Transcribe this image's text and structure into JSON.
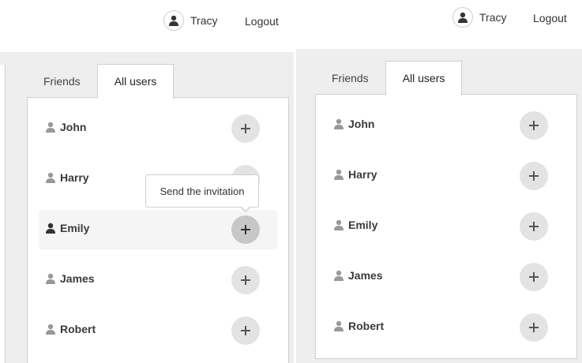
{
  "left_panel": {
    "user": {
      "name": "Tracy",
      "avatar_icon": "user-icon"
    },
    "logout_label": "Logout",
    "tabs": [
      {
        "label": "Friends",
        "active": false
      },
      {
        "label": "All users",
        "active": true
      }
    ],
    "users": [
      {
        "name": "John",
        "icon": "person-icon",
        "action_icon": "plus-icon"
      },
      {
        "name": "Harry",
        "icon": "person-icon",
        "action_icon": "plus-icon"
      },
      {
        "name": "Emily",
        "icon": "person-icon",
        "action_icon": "plus-icon",
        "hovered": true
      },
      {
        "name": "James",
        "icon": "person-icon",
        "action_icon": "plus-icon"
      },
      {
        "name": "Robert",
        "icon": "person-icon",
        "action_icon": "plus-icon"
      }
    ],
    "tooltip": "Send the invitation"
  },
  "right_panel": {
    "user": {
      "name": "Tracy",
      "avatar_icon": "user-icon"
    },
    "logout_label": "Logout",
    "tabs": [
      {
        "label": "Friends",
        "active": false
      },
      {
        "label": "All users",
        "active": true
      }
    ],
    "users": [
      {
        "name": "John",
        "icon": "person-icon",
        "action_icon": "plus-icon"
      },
      {
        "name": "Harry",
        "icon": "person-icon",
        "action_icon": "plus-icon"
      },
      {
        "name": "Emily",
        "icon": "person-icon",
        "action_icon": "plus-icon"
      },
      {
        "name": "James",
        "icon": "person-icon",
        "action_icon": "plus-icon"
      },
      {
        "name": "Robert",
        "icon": "person-icon",
        "action_icon": "plus-icon"
      }
    ]
  },
  "colors": {
    "page_bg": "#eeeeee",
    "card_border": "#cfcfcf",
    "button_bg": "#e3e3e3",
    "button_hover_bg": "#c7c7c7",
    "row_hover_bg": "#f5f5f5",
    "icon_gray": "#999999",
    "icon_dark": "#333333"
  }
}
